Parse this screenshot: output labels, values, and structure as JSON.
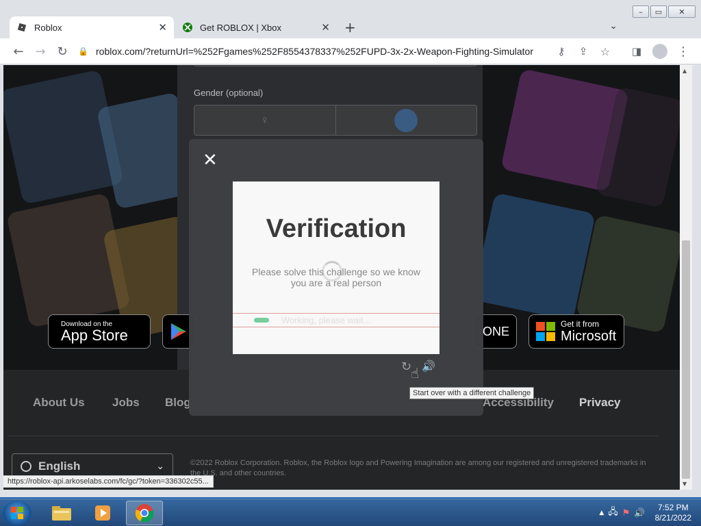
{
  "browser": {
    "tabs": [
      {
        "label": "Roblox",
        "active": true
      },
      {
        "label": "Get ROBLOX | Xbox",
        "active": false
      }
    ],
    "url": "roblox.com/?returnUrl=%252Fgames%252F8554378337%252FUPD-3x-2x-Weapon-Fighting-Simulator",
    "status_url": "https://roblox-api.arkoselabs.com/fc/gc/?token=336302c55..."
  },
  "page": {
    "gender_label": "Gender (optional)",
    "badges": {
      "appstore_small": "Download on the",
      "appstore_big": "App Store",
      "xbox_text": "ONE",
      "microsoft_small": "Get it from",
      "microsoft_big": "Microsoft"
    },
    "footer_links": [
      "About Us",
      "Jobs",
      "Blog",
      "Accessibility",
      "Privacy"
    ],
    "language": "English",
    "copyright": "©2022 Roblox Corporation. Roblox, the Roblox logo and Powering Imagination are among our registered and unregistered trademarks in the U.S. and other countries."
  },
  "modal": {
    "title": "Verification",
    "description": "Please solve this challenge so we know you are a real person",
    "progress_text": "Working, please wait...",
    "tooltip": "Start over with a different challenge"
  },
  "taskbar": {
    "time": "7:52 PM",
    "date": "8/21/2022"
  },
  "colors": {
    "accent_green": "#79d3a1",
    "taskbar": "#2a5288"
  }
}
